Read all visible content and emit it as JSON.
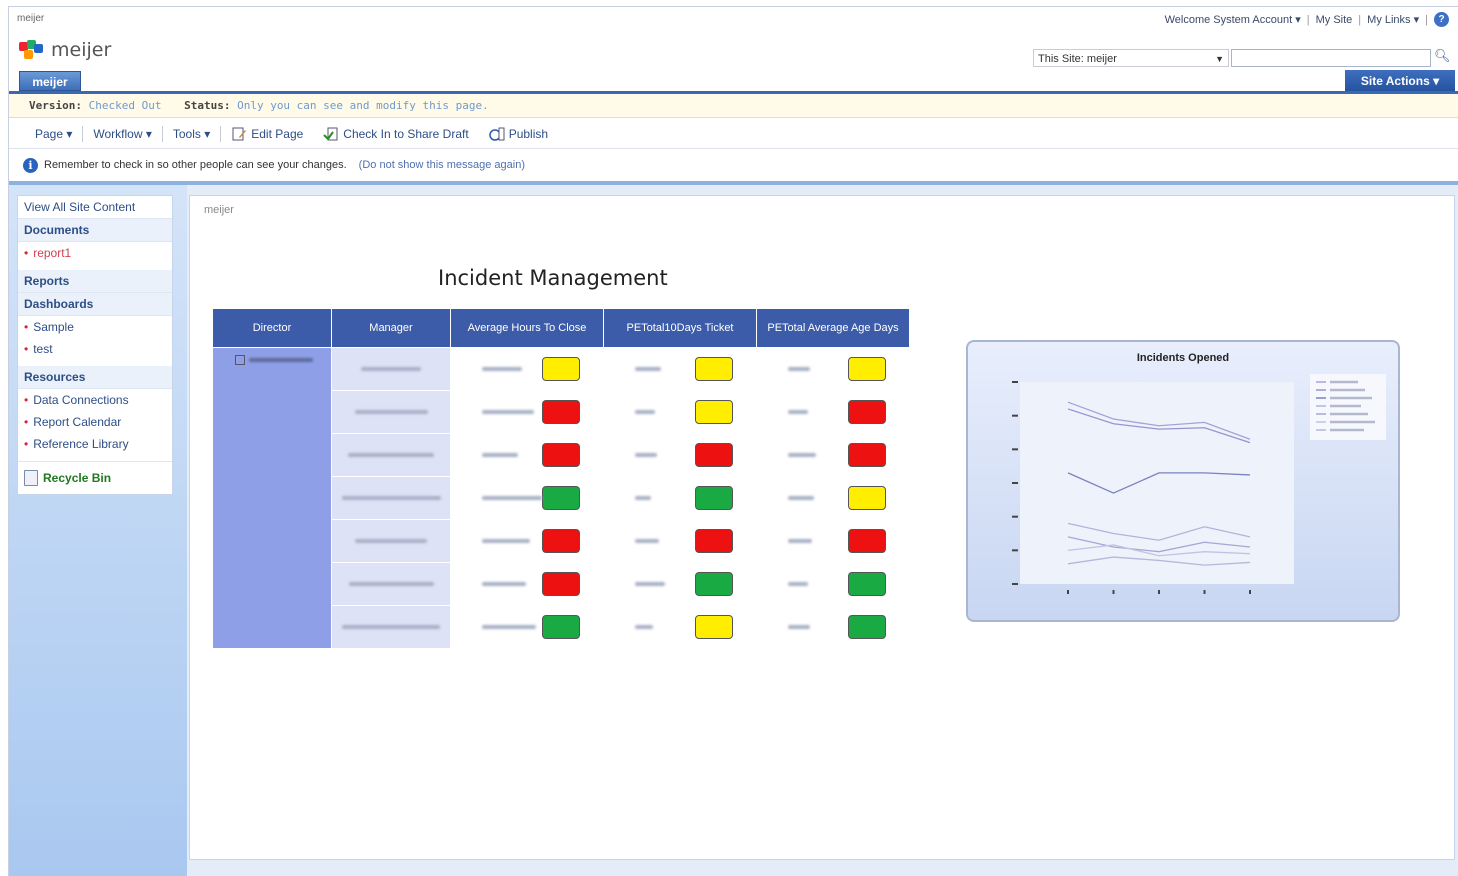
{
  "topbar": {
    "crumb": "meijer",
    "welcome": "Welcome System Account ▾",
    "my_site": "My Site",
    "my_links": "My Links ▾",
    "sep": "|",
    "help_glyph": "?"
  },
  "header": {
    "logo_text": "meijer",
    "search_scope": "This Site: meijer",
    "search_value": "",
    "tab": "meijer",
    "site_actions": "Site Actions ▾"
  },
  "status": {
    "version_label": "Version:",
    "version_value": "Checked Out",
    "status_label": "Status:",
    "status_value": "Only you can see and modify this page."
  },
  "toolbar": {
    "page": "Page ▾",
    "workflow": "Workflow ▾",
    "tools": "Tools ▾",
    "edit_page": "Edit Page",
    "check_in": "Check In to Share Draft",
    "publish": "Publish"
  },
  "message": {
    "text": "Remember to check in so other people can see your changes.",
    "link": "(Do not show this message again)"
  },
  "quicklaunch": {
    "view_all": "View All Site Content",
    "documents": "Documents",
    "doc_items": [
      "report1"
    ],
    "reports": "Reports",
    "dashboards": "Dashboards",
    "dash_items": [
      "Sample",
      "test"
    ],
    "resources": "Resources",
    "res_items": [
      "Data Connections",
      "Report Calendar",
      "Reference Library"
    ],
    "recycle": "Recycle Bin"
  },
  "content": {
    "crumb": "meijer",
    "title": "Incident Management"
  },
  "table": {
    "headers": [
      "Director",
      "Manager",
      "Average Hours To Close",
      "PETotal10Days Ticket",
      "PETotal Average Age Days"
    ],
    "rows": [
      {
        "lights": [
          "yellow",
          "yellow",
          "yellow"
        ]
      },
      {
        "lights": [
          "red",
          "yellow",
          "red"
        ]
      },
      {
        "lights": [
          "red",
          "red",
          "red"
        ]
      },
      {
        "lights": [
          "green",
          "green",
          "yellow"
        ]
      },
      {
        "lights": [
          "red",
          "red",
          "red"
        ]
      },
      {
        "lights": [
          "red",
          "green",
          "green"
        ]
      },
      {
        "lights": [
          "green",
          "yellow",
          "green"
        ]
      }
    ]
  },
  "colors": {
    "yellow": "#ffee00",
    "red": "#ee1111",
    "green": "#1aaa44",
    "header_blue": "#3c5ba8"
  },
  "chart_data": {
    "type": "line",
    "title": "Incidents Opened",
    "xlabel": "",
    "ylabel": "",
    "series": [
      {
        "values": [
          270,
          245,
          235,
          240,
          215
        ]
      },
      {
        "values": [
          260,
          238,
          230,
          232,
          210
        ]
      },
      {
        "values": [
          165,
          135,
          165,
          165,
          162
        ]
      },
      {
        "values": [
          90,
          75,
          65,
          85,
          70
        ]
      },
      {
        "values": [
          70,
          55,
          48,
          62,
          55
        ]
      },
      {
        "values": [
          50,
          58,
          42,
          48,
          45
        ]
      },
      {
        "values": [
          30,
          40,
          35,
          28,
          32
        ]
      }
    ],
    "ylim": [
      0,
      300
    ],
    "grid": false,
    "legend": "top-right"
  }
}
